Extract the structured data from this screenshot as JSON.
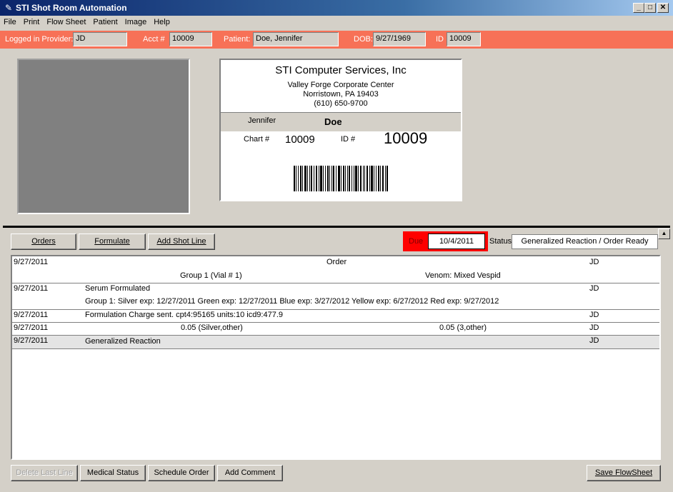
{
  "window": {
    "title": "STI Shot Room Automation",
    "app_icon": "pencil-icon",
    "controls": {
      "minimize": "_",
      "maximize": "□",
      "close": "✕"
    }
  },
  "menu": {
    "items": [
      "File",
      "Print",
      "Flow Sheet",
      "Patient",
      "Image",
      "Help"
    ]
  },
  "header": {
    "provider_label": "Logged in Provider:",
    "provider_value": "JD",
    "acct_label": "Acct #",
    "acct_value": "10009",
    "patient_label": "Patient:",
    "patient_value": "Doe, Jennifer",
    "dob_label": "DOB:",
    "dob_value": "9/27/1969",
    "id_label": "ID",
    "id_value": "10009"
  },
  "card": {
    "company": "STI Computer Services, Inc",
    "address1": "Valley Forge Corporate Center",
    "address2": "Norristown, PA 19403",
    "phone": "(610) 650-9700",
    "first_name": "Jennifer",
    "last_name": "Doe",
    "chart_label": "Chart #",
    "chart_value": "10009",
    "id_label": "ID #",
    "id_value": "10009"
  },
  "toolbar": {
    "orders": "Orders",
    "formulate": "Formulate",
    "add_shot_line": "Add Shot Line",
    "due_label": "Due",
    "due_value": "10/4/2011",
    "status_label": "Status",
    "status_value": "Generalized Reaction / Order Ready"
  },
  "grid": {
    "rows": [
      {
        "date": "9/27/2011",
        "center": "Order",
        "user": "JD",
        "line2_left": "Group 1 (Vial # 1)",
        "line2_right": "Venom: Mixed Vespid",
        "shaded": false
      },
      {
        "date": "9/27/2011",
        "text": "Serum Formulated",
        "user": "JD",
        "line2": "Group 1:   Silver exp: 12/27/2011  Green exp: 12/27/2011  Blue exp: 3/27/2012  Yellow exp: 6/27/2012  Red exp: 9/27/2012",
        "shaded": false
      },
      {
        "date": "9/27/2011",
        "text": "Formulation Charge sent.   cpt4:95165  units:10  icd9:477.9",
        "user": "JD",
        "shaded": false
      },
      {
        "date": "9/27/2011",
        "left_val": "0.05 (Silver,other)",
        "right_val": "0.05 (3,other)",
        "user": "JD",
        "shaded": false
      },
      {
        "date": "9/27/2011",
        "text": "Generalized Reaction",
        "user": "JD",
        "shaded": true
      }
    ]
  },
  "footer": {
    "delete_last_line": "Delete Last Line",
    "medical_status": "Medical Status",
    "schedule_order": "Schedule Order",
    "add_comment": "Add Comment",
    "save_flowsheet": "Save FlowSheet"
  },
  "colors": {
    "header_strip": "#f77157",
    "due_highlight": "#ff0000",
    "title_bar": "#0a246a"
  }
}
